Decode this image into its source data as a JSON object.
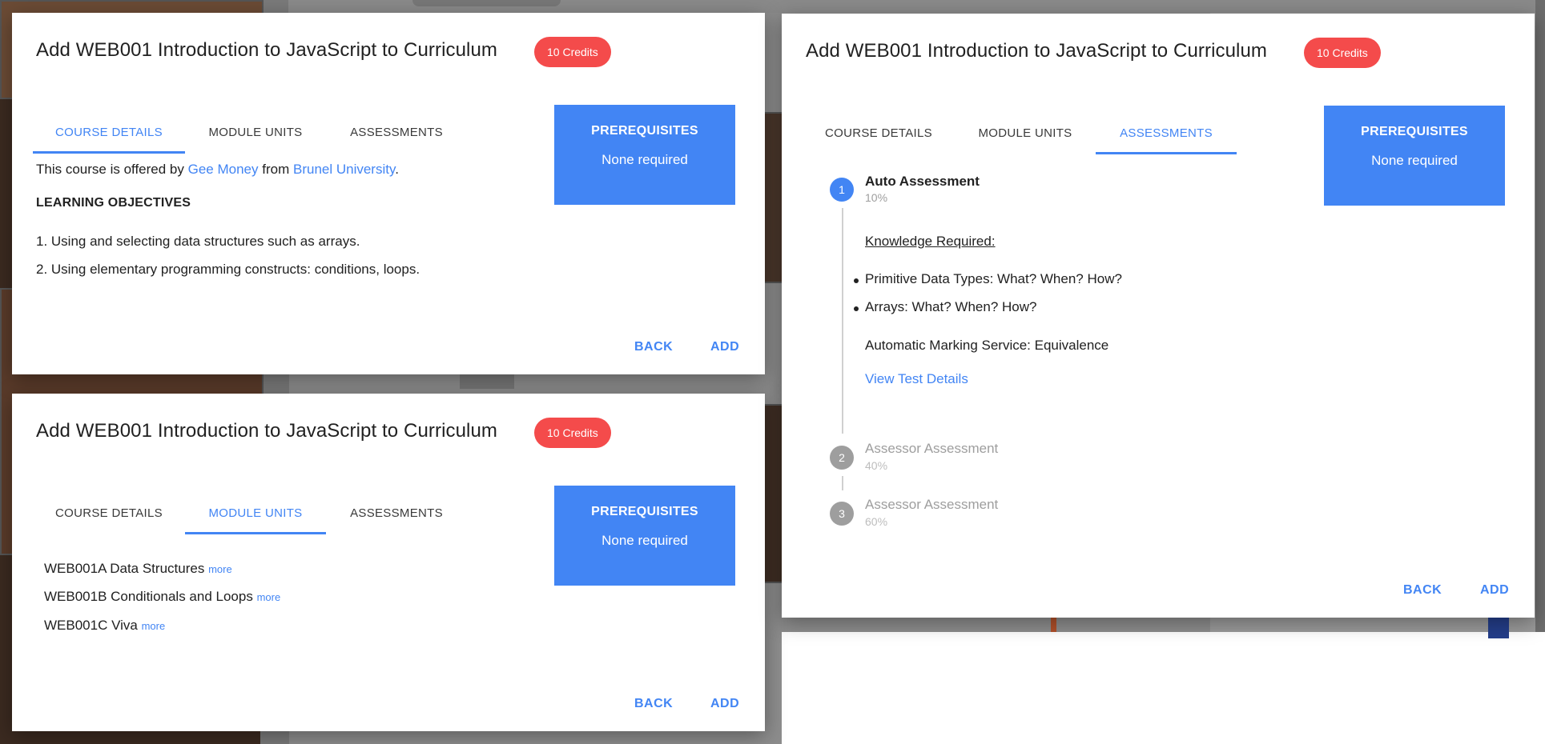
{
  "colors": {
    "accent": "#4285f4",
    "badge": "#f44b4b",
    "inactive_step": "#9e9e9e"
  },
  "dialog_title": "Add WEB001 Introduction to JavaScript to Curriculum",
  "credits_badge": "10 Credits",
  "tabs": {
    "course_details": "COURSE DETAILS",
    "module_units": "MODULE UNITS",
    "assessments": "ASSESSMENTS"
  },
  "prerequisites": {
    "title": "PREREQUISITES",
    "value": "None required"
  },
  "actions": {
    "back": "BACK",
    "add": "ADD"
  },
  "course_details": {
    "offered_prefix": "This course is offered by",
    "author": "Gee Money",
    "from_word": "from",
    "institution": "Brunel University",
    "period": ".",
    "objectives_heading": "LEARNING OBJECTIVES",
    "objectives": [
      "1. Using and selecting data structures such as arrays.",
      "2. Using elementary programming constructs: conditions, loops."
    ]
  },
  "module_units": {
    "more_label": "more",
    "units": [
      "WEB001A Data Structures",
      "WEB001B Conditionals and Loops",
      "WEB001C Viva"
    ]
  },
  "assessments": {
    "steps": [
      {
        "number": "1",
        "title": "Auto Assessment",
        "weight": "10%"
      },
      {
        "number": "2",
        "title": "Assessor Assessment",
        "weight": "40%"
      },
      {
        "number": "3",
        "title": "Assessor Assessment",
        "weight": "60%"
      }
    ],
    "knowledge_heading": "Knowledge Required:",
    "knowledge_items": [
      "Primitive Data Types: What? When? How?",
      "Arrays: What? When? How?"
    ],
    "marking_service": "Automatic Marking Service: Equivalence",
    "view_test_details": "View Test Details"
  }
}
